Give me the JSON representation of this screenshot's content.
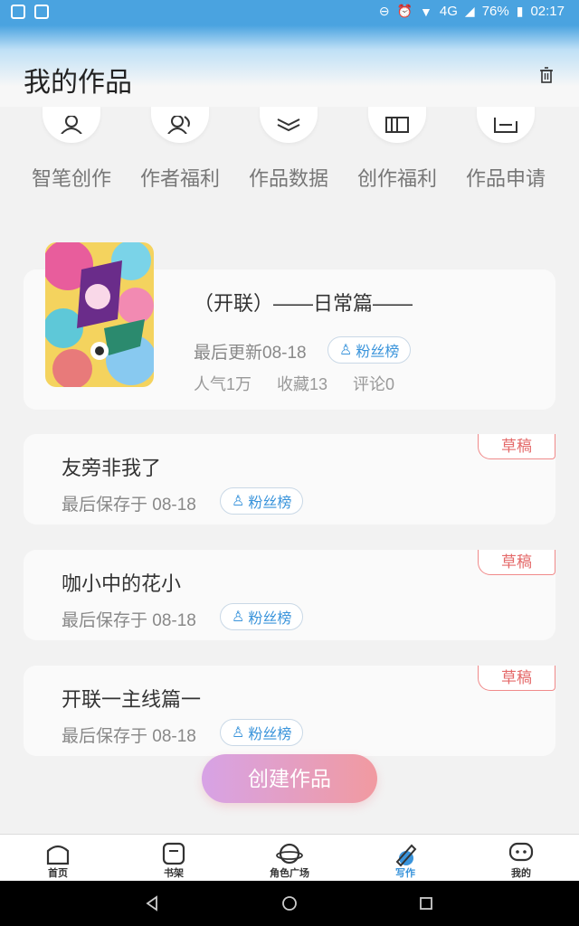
{
  "status": {
    "network": "4G",
    "battery": "76%",
    "time": "02:17"
  },
  "header": {
    "title": "我的作品"
  },
  "quick_actions": [
    {
      "label": "智笔创作"
    },
    {
      "label": "作者福利"
    },
    {
      "label": "作品数据"
    },
    {
      "label": "创作福利"
    },
    {
      "label": "作品申请"
    }
  ],
  "work": {
    "title": "（开联）——日常篇——",
    "updated": "最后更新08-18",
    "fans_label": "粉丝榜",
    "popularity": "人气1万",
    "favorites": "收藏13",
    "comments": "评论0"
  },
  "drafts": [
    {
      "title": "友旁非我了",
      "saved": "最后保存于 08-18",
      "fans_label": "粉丝榜",
      "tag": "草稿"
    },
    {
      "title": "咖小中的花小",
      "saved": "最后保存于 08-18",
      "fans_label": "粉丝榜",
      "tag": "草稿"
    },
    {
      "title": "开联一主线篇一",
      "saved": "最后保存于 08-18",
      "fans_label": "粉丝榜",
      "tag": "草稿"
    }
  ],
  "create_button": "创建作品",
  "tabs": [
    {
      "label": "首页"
    },
    {
      "label": "书架"
    },
    {
      "label": "角色广场"
    },
    {
      "label": "写作"
    },
    {
      "label": "我的"
    }
  ],
  "colors": {
    "accent": "#3a94db",
    "draft": "#e46a6a",
    "create_start": "#d7a3e6",
    "create_end": "#f19aa0"
  }
}
